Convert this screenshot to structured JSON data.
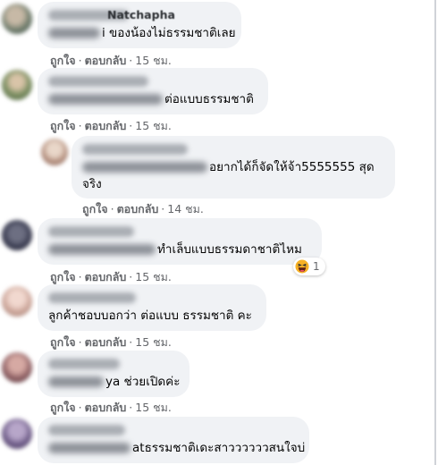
{
  "comments": [
    {
      "partial_name": "Natchapha",
      "text_visible": "i ของน้องไม่ธรรมชาติเลย",
      "like": "ถูกใจ",
      "reply": "ตอบกลับ",
      "time": "15 ชม."
    },
    {
      "text_visible": "ต่อแบบธรรมชาติ",
      "like": "ถูกใจ",
      "reply": "ตอบกลับ",
      "time": "15 ชม."
    },
    {
      "text_visible_1": "อยากได้ก็จัดให้จ้า5555555 สุด",
      "text_visible_2": "จริง",
      "like": "ถูกใจ",
      "reply": "ตอบกลับ",
      "time": "14 ชม."
    },
    {
      "text_visible": "ทำเล็บแบบธรรมดาชาติไหม",
      "reaction_icon": "haha-emoji-icon",
      "reaction_count": "1",
      "like": "ถูกใจ",
      "reply": "ตอบกลับ",
      "time": "15 ชม."
    },
    {
      "text_visible": "ลูกค้าชอบบอกว่า ต่อแบบ ธรรมชาติ คะ",
      "like": "ถูกใจ",
      "reply": "ตอบกลับ",
      "time": "15 ชม."
    },
    {
      "text_visible": "ya ช่วยเปิดค่ะ",
      "like": "ถูกใจ",
      "reply": "ตอบกลับ",
      "time": "15 ชม."
    },
    {
      "text_visible": "atธรรมชาติเดะสาววววววสนใจบ่"
    }
  ],
  "separator": "·",
  "colors": {
    "bubble": "#f0f2f5",
    "action_text": "#65676b",
    "text": "#050505"
  }
}
